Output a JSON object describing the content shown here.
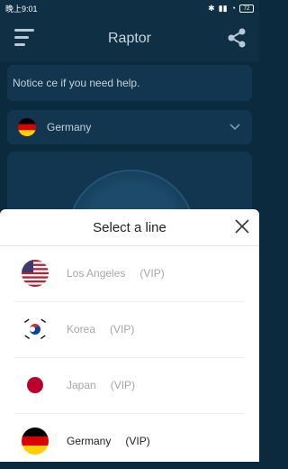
{
  "status": {
    "time": "晚上9:01",
    "battery": "72"
  },
  "app": {
    "title": "Raptor"
  },
  "notice": {
    "text": "Notice  ce if you need help."
  },
  "selected_country": {
    "name": "Germany",
    "flag": "germany-flag"
  },
  "sheet": {
    "title": "Select a line",
    "items": [
      {
        "name": "Los Angeles",
        "tag": "(VIP)",
        "flag": "usa-flag",
        "enabled": false
      },
      {
        "name": "Korea",
        "tag": "(VIP)",
        "flag": "korea-flag",
        "enabled": false
      },
      {
        "name": "Japan",
        "tag": "(VIP)",
        "flag": "japan-flag",
        "enabled": false
      },
      {
        "name": "Germany",
        "tag": "(VIP)",
        "flag": "germany-flag",
        "enabled": true
      }
    ]
  },
  "colors": {
    "header_bg": "#0e2f44",
    "disabled_text": "#a7a7a7"
  }
}
